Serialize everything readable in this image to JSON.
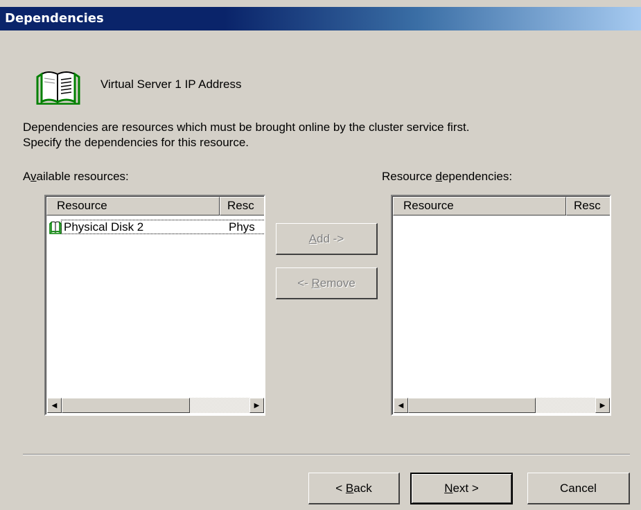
{
  "window": {
    "title": "Dependencies"
  },
  "header": {
    "resource_name": "Virtual Server 1 IP Address"
  },
  "description": {
    "line1": "Dependencies are resources which must be brought online by the cluster service first.",
    "line2": "Specify the dependencies for this resource."
  },
  "available": {
    "label_pre": "A",
    "label_key": "v",
    "label_post": "ailable resources:",
    "columns": [
      "Resource",
      "Resc"
    ],
    "rows": [
      {
        "name": "Physical Disk 2",
        "type": "Phys"
      }
    ]
  },
  "dependencies": {
    "label_pre": "Resource ",
    "label_key": "d",
    "label_post": "ependencies:",
    "columns": [
      "Resource",
      "Resc"
    ]
  },
  "buttons": {
    "add_key": "A",
    "add_rest": "dd ->",
    "remove_pre": "<- ",
    "remove_key": "R",
    "remove_rest": "emove",
    "back_pre": "< ",
    "back_key": "B",
    "back_rest": "ack",
    "next_key": "N",
    "next_rest": "ext >",
    "cancel": "Cancel"
  },
  "colors": {
    "face": "#d4d0c8",
    "title_start": "#0a246a",
    "title_end": "#a6caf0",
    "icon_green": "#008000"
  }
}
